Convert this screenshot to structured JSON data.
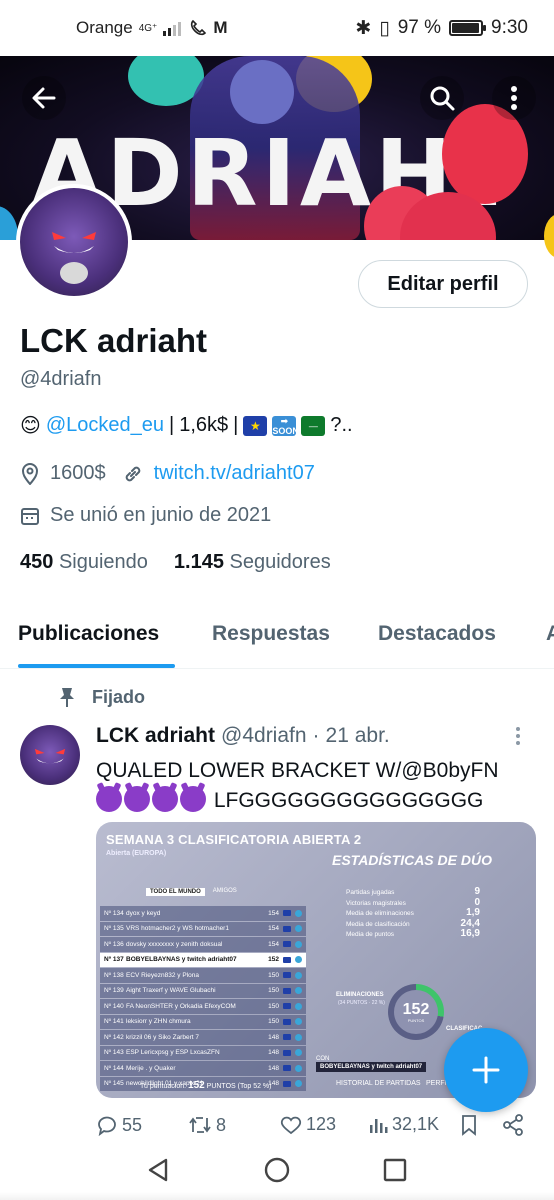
{
  "status_bar": {
    "carrier": "Orange",
    "network": "4G⁺",
    "battery": "97 %",
    "battery_level": 0.97,
    "time": "9:30"
  },
  "banner": {
    "title": "ADRIAHT",
    "colors": {
      "background": "#120d22",
      "balloon_red": "#e8324a",
      "balloon_yellow": "#f5c518",
      "balloon_blue": "#2a9fd8"
    }
  },
  "header": {
    "back_icon": "arrow-left-icon",
    "search_icon": "search-icon",
    "more_icon": "more-vertical-icon"
  },
  "profile": {
    "edit_button": "Editar perfil",
    "name": "LCK adriaht",
    "handle": "@4driafn",
    "bio": {
      "emoji": "😊",
      "mention": "@Locked_eu",
      "sep1": "|",
      "earnings": "1,6k$",
      "sep2": "|",
      "tail": "?.."
    },
    "location": "1600$",
    "website": "twitch.tv/adriaht07",
    "joined": "Se unió en junio de 2021",
    "following_count": "450",
    "following_label": "Siguiendo",
    "followers_count": "1.145",
    "followers_label": "Seguidores"
  },
  "tabs": [
    "Publicaciones",
    "Respuestas",
    "Destacados",
    "A"
  ],
  "tweet": {
    "pinned_label": "Fijado",
    "author_name": "LCK adriaht",
    "author_handle": "@4driafn",
    "dot": "·",
    "date": "21 abr.",
    "text_line1": "QUALED LOWER BRACKET W/@B0byFN",
    "text_line2": "LFGGGGGGGGGGGGGGG",
    "image": {
      "title": "SEMANA 3 CLASIFICATORIA ABIERTA 2",
      "subtitle": "Abierta (EUROPA)",
      "stats_title": "ESTADÍSTICAS DE DÚO",
      "tab_all": "TODO EL MUNDO",
      "tab_friends": "AMIGOS",
      "rows": [
        {
          "rank": "Nº 134",
          "name": "dyox y keyd",
          "pts": "154"
        },
        {
          "rank": "Nº 135",
          "name": "VRS hotmacher2 y WS hotmacher1",
          "pts": "154"
        },
        {
          "rank": "Nº 136",
          "name": "dovsky xxxxxxxx y zenith doksual",
          "pts": "154"
        },
        {
          "rank": "Nº 137",
          "name": "BOBYELBAYNAS y twitch adriaht07",
          "pts": "152"
        },
        {
          "rank": "Nº 138",
          "name": "ECV Rieyezn832 y Plona",
          "pts": "150"
        },
        {
          "rank": "Nº 139",
          "name": "Aight Traxerf y WAVE Glubachi",
          "pts": "150"
        },
        {
          "rank": "Nº 140",
          "name": "FA NeonSHTER y Orkadia EfexyCOM",
          "pts": "150"
        },
        {
          "rank": "Nº 141",
          "name": "leksiorr y ZHN chmura",
          "pts": "150"
        },
        {
          "rank": "Nº 142",
          "name": "krizzil 06 y Siko Zarbert 7",
          "pts": "148"
        },
        {
          "rank": "Nº 143",
          "name": "ESP Lericxpsg y ESP LxcasZFN",
          "pts": "148"
        },
        {
          "rank": "Nº 144",
          "name": "Merije . y Quaker",
          "pts": "148"
        },
        {
          "rank": "Nº 145",
          "name": "newchildlight 01 y xapix 21",
          "pts": "148"
        }
      ],
      "my_row_index": 3,
      "score_prefix": "Tu puntuación:",
      "score_value": "152",
      "score_suffix": "PUNTOS   (Top 52 %)",
      "stats": [
        {
          "label": "Partidas jugadas",
          "value": "9"
        },
        {
          "label": "Victorias magistrales",
          "value": "0"
        },
        {
          "label": "Media de eliminaciones",
          "value": "1,9"
        },
        {
          "label": "Media de clasificación",
          "value": "24,4"
        },
        {
          "label": "Media de puntos",
          "value": "16,9"
        }
      ],
      "ring_value": "152",
      "ring_label": "PUNTOS",
      "elim_label": "ELIMINACIONES",
      "elim_sub": "(34 PUNTOS · 22 %)",
      "clasif_label": "CLASIFICAC",
      "con_label": "CON",
      "team_label": "BOBYELBAYNAS y twitch adriaht07",
      "history": "HISTORIAL DE PARTIDAS",
      "profile_short": "PERFIL"
    },
    "replies": "55",
    "retweets": "8",
    "likes": "123",
    "views": "32,1K"
  },
  "fab_icon": "plus-icon",
  "navbar": [
    "back-triangle-icon",
    "home-circle-icon",
    "recents-square-icon"
  ]
}
